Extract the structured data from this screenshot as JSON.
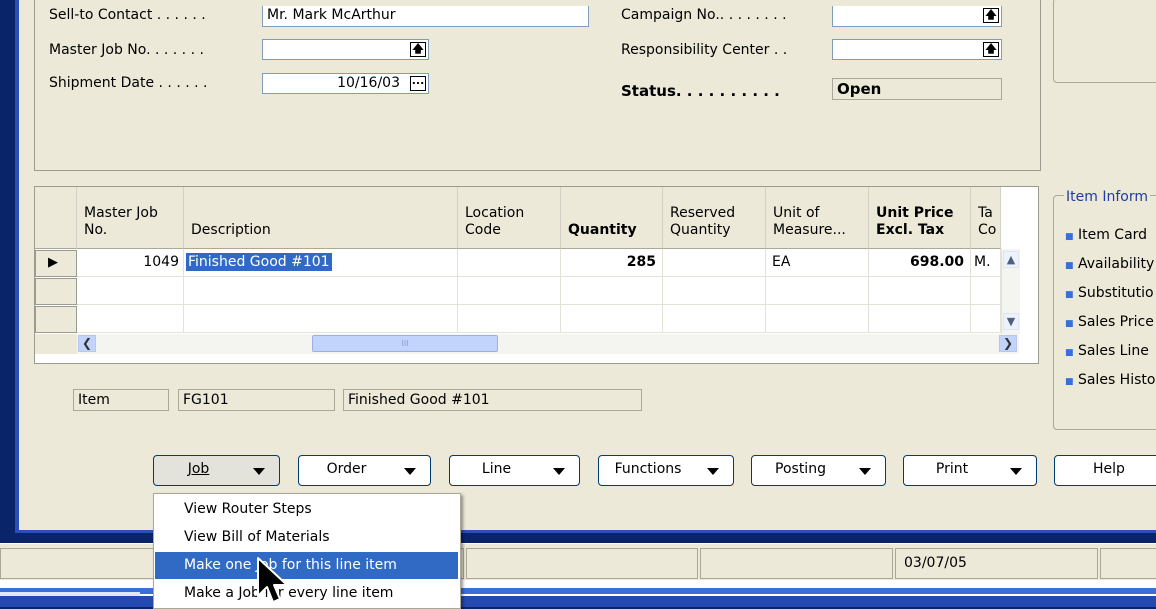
{
  "header": {
    "sell_to_contact_label": "Sell-to Contact . . . . . .",
    "sell_to_contact_value": "Mr. Mark McArthur",
    "master_job_no_label": "Master Job No. . . . . . .",
    "master_job_no_value": "",
    "shipment_date_label": "Shipment Date . . . . . .",
    "shipment_date_value": "10/16/03",
    "campaign_no_label": "Campaign No.. . . . . . . .",
    "responsibility_center_label": "Responsibility Center . .",
    "status_label": "Status. . . . . . . . . .",
    "status_value": "Open"
  },
  "item_info": {
    "title": "Item Inform",
    "links": [
      "Item Card",
      "Availability",
      "Substitutio",
      "Sales Price",
      "Sales Line",
      "Sales Histo"
    ]
  },
  "grid": {
    "columns": [
      {
        "label1": "Master Job",
        "label2": "No."
      },
      {
        "label1": "",
        "label2": "Description"
      },
      {
        "label1": "Location",
        "label2": "Code"
      },
      {
        "label1": "",
        "label2": "Quantity"
      },
      {
        "label1": "Reserved",
        "label2": "Quantity"
      },
      {
        "label1": "Unit of",
        "label2": "Measure..."
      },
      {
        "label1": "Unit Price",
        "label2": "Excl. Tax"
      },
      {
        "label1": "Ta",
        "label2": "Co"
      }
    ],
    "row": {
      "master_job_no": "1049",
      "description": "Finished Good #101",
      "location": "",
      "quantity": "285",
      "reserved": "",
      "uom": "EA",
      "unit_price": "698.00",
      "tax": "M."
    },
    "scroll_thumb_grip": "III"
  },
  "footer_info": {
    "type": "Item",
    "no": "FG101",
    "description": "Finished Good #101"
  },
  "buttons": {
    "job": "Job",
    "order": "Order",
    "line": "Line",
    "functions": "Functions",
    "posting": "Posting",
    "print": "Print",
    "help": "Help"
  },
  "job_menu": {
    "items": [
      "View Router Steps",
      "View Bill of Materials",
      "Make one Job for this line item",
      "Make a Job for every line item"
    ],
    "highlighted_index": 2
  },
  "statusbar": {
    "date": "03/07/05"
  },
  "colors": {
    "accent": "#316ac5",
    "window_bg": "#ece9d8",
    "frame_blue": "#0a246a",
    "link_blue": "#1f3ca0"
  }
}
